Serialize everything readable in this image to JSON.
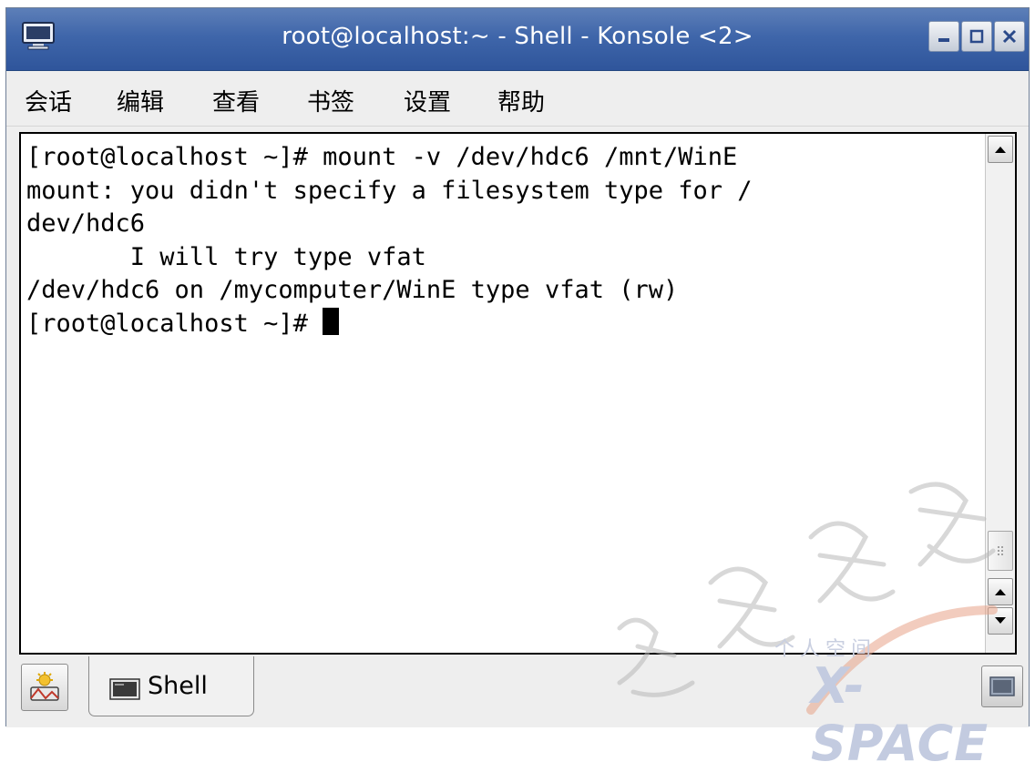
{
  "window": {
    "title": "root@localhost:~ - Shell - Konsole <2>"
  },
  "menubar": {
    "items": [
      "会话",
      "编辑",
      "查看",
      "书签",
      "设置",
      "帮助"
    ]
  },
  "terminal": {
    "lines": [
      "[root@localhost ~]# mount -v /dev/hdc6 /mnt/WinE",
      "mount: you didn't specify a filesystem type for /",
      "dev/hdc6",
      "       I will try type vfat",
      "/dev/hdc6 on /mycomputer/WinE type vfat (rw)"
    ],
    "prompt": "[root@localhost ~]# "
  },
  "tabbar": {
    "tabs": [
      {
        "label": "Shell",
        "icon": "terminal-icon",
        "active": true
      }
    ],
    "new_tab_icon": "new-session-icon",
    "close_tab_icon": "close-session-icon"
  },
  "watermark": {
    "brand_cn": "个人空间",
    "brand_en": "X-SPACE",
    "icon": "calligraphy-watermark-icon"
  },
  "colors": {
    "titlebar": "#3f66aa",
    "title_text": "#ffffff",
    "terminal_bg": "#ffffff",
    "terminal_fg": "#000000",
    "chrome_bg": "#eeeeee"
  }
}
